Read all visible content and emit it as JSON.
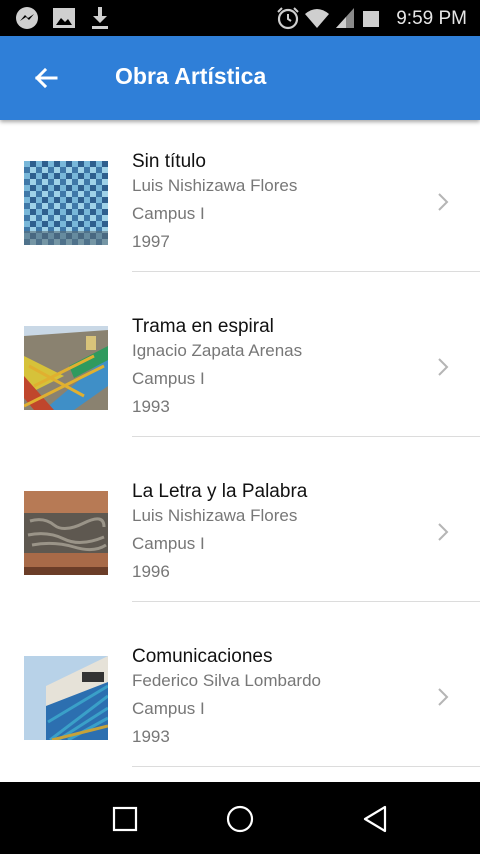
{
  "status_bar": {
    "time": "9:59 PM",
    "left_icons": [
      "messenger-icon",
      "gallery-icon",
      "download-icon"
    ],
    "right_icons": [
      "alarm-icon",
      "wifi-icon",
      "signal-icon",
      "battery-icon"
    ]
  },
  "app_bar": {
    "title": "Obra Artística",
    "back_icon": "arrow-left-icon",
    "color": "#2f7fd8"
  },
  "items": [
    {
      "title": "Sin título",
      "artist": "Luis Nishizawa Flores",
      "campus": "Campus I",
      "year": "1997",
      "thumbnail": "blue-mosaic-tiles"
    },
    {
      "title": "Trama en espiral",
      "artist": "Ignacio Zapata Arenas",
      "campus": "Campus I",
      "year": "1993",
      "thumbnail": "colorful-diagonal-mural"
    },
    {
      "title": "La Letra y la Palabra",
      "artist": "Luis Nishizawa Flores",
      "campus": "Campus I",
      "year": "1996",
      "thumbnail": "brown-relief-mural"
    },
    {
      "title": "Comunicaciones",
      "artist": "Federico Silva Lombardo",
      "campus": "Campus I",
      "year": "1993",
      "thumbnail": "building-facade-mural"
    }
  ],
  "nav_bar": {
    "buttons": [
      "recent-apps-icon",
      "home-icon",
      "back-icon"
    ]
  }
}
